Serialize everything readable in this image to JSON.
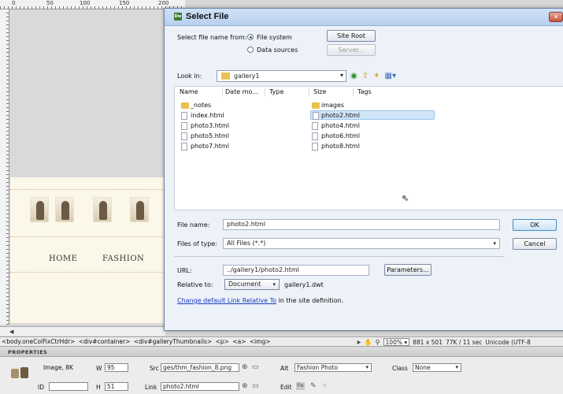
{
  "ruler": {
    "marks": [
      "0",
      "50",
      "100",
      "150",
      "200"
    ]
  },
  "design": {
    "nav": [
      "HOME",
      "FASHION"
    ]
  },
  "status": {
    "tags": [
      "<body.oneColFixCtrHdr>",
      "<div#container>",
      "<div#galleryThumbnails>",
      "<p>",
      "<a>",
      "<img>"
    ],
    "zoom": "100%",
    "dimensions": "881 x 501",
    "download": "77K / 11 sec",
    "encoding": "Unicode (UTF-8"
  },
  "properties": {
    "header": "PROPERTIES",
    "image_label": "Image, 8K",
    "id_label": "ID",
    "w_label": "W",
    "w_value": "95",
    "h_label": "H",
    "h_value": "51",
    "src_label": "Src",
    "src_value": "ges/thm_fashion_8.png",
    "link_label": "Link",
    "link_value": "photo2.html",
    "alt_label": "Alt",
    "alt_value": "Fashion Photo",
    "edit_label": "Edit",
    "class_label": "Class",
    "class_value": "None"
  },
  "dialog": {
    "title": "Select File",
    "select_from_label": "Select file name from:",
    "radio_file_system": "File system",
    "radio_data_sources": "Data sources",
    "site_root_button": "Site Root",
    "server_button": "Server...",
    "look_in_label": "Look in:",
    "look_in_value": "gallery1",
    "columns": [
      "Name",
      "Date mo...",
      "Type",
      "Size",
      "Tags"
    ],
    "files_col1": [
      {
        "name": "_notes",
        "type": "folder"
      },
      {
        "name": "index.html",
        "type": "file"
      },
      {
        "name": "photo3.html",
        "type": "file"
      },
      {
        "name": "photo5.html",
        "type": "file"
      },
      {
        "name": "photo7.html",
        "type": "file"
      }
    ],
    "files_col2": [
      {
        "name": "images",
        "type": "folder"
      },
      {
        "name": "photo2.html",
        "type": "file",
        "selected": true
      },
      {
        "name": "photo4.html",
        "type": "file"
      },
      {
        "name": "photo6.html",
        "type": "file"
      },
      {
        "name": "photo8.html",
        "type": "file"
      }
    ],
    "file_name_label": "File name:",
    "file_name_value": "photo2.html",
    "files_of_type_label": "Files of type:",
    "files_of_type_value": "All Files (*.*)",
    "ok_button": "OK",
    "cancel_button": "Cancel",
    "url_label": "URL:",
    "url_value": "../gallery1/photo2.html",
    "parameters_button": "Parameters...",
    "relative_label": "Relative to:",
    "relative_value": "Document",
    "relative_doc": "gallery1.dwt",
    "change_link_text": "Change default Link Relative To",
    "change_link_suffix": "in the site definition."
  },
  "colors": {
    "titlebar": "#b8d0ef",
    "selection": "#cfe5f8",
    "link": "#1a3dc1"
  }
}
